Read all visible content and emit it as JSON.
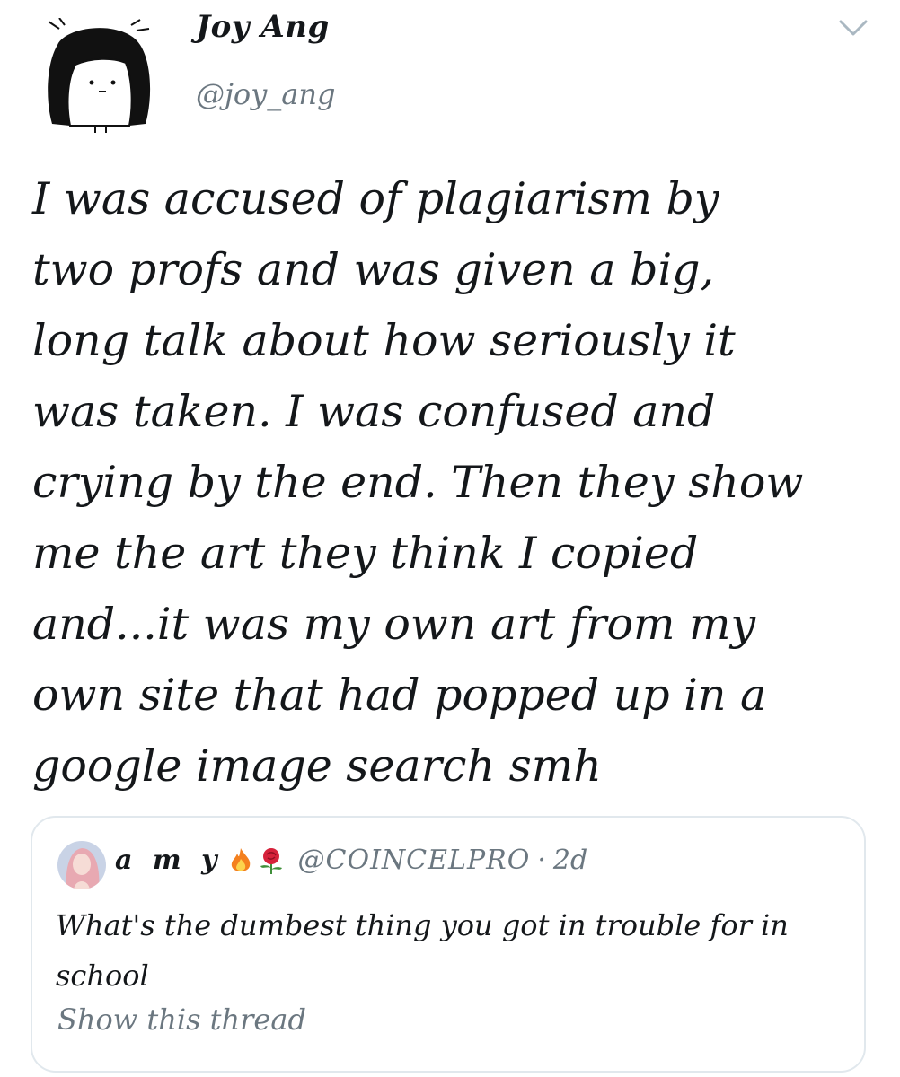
{
  "author": {
    "display_name": "Joy Ang",
    "handle": "@joy_ang",
    "avatar_icon": "cartoon-girl-avatar"
  },
  "tweet": {
    "text": "I was accused of plagiarism by\ntwo profs and was given a big,\nlong talk about how seriously it\nwas taken. I was confused and\ncrying by the end. Then they show\nme the art they think I copied\nand...it was my own art from my\nown site that had popped up in a\ngoogle image search smh"
  },
  "menu": {
    "icon": "chevron-down-icon"
  },
  "quoted_tweet": {
    "name": "a m y",
    "emojis": [
      "fire-emoji",
      "rose-emoji"
    ],
    "handle": "@COINCELPRO",
    "separator": "·",
    "time": "2d",
    "text": "What's the dumbest thing you got in trouble for in school",
    "show_thread_label": "Show this thread"
  },
  "colors": {
    "text": "#14171a",
    "secondary": "#6b7780",
    "border": "#e1e8ed"
  }
}
